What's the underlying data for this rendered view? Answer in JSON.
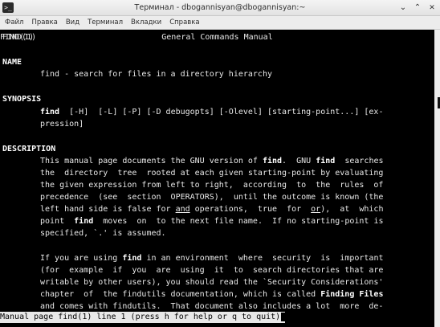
{
  "window": {
    "title": "Терминал - dbogannisyan@dbogannisyan:~",
    "app_icon": "terminal-icon"
  },
  "menu": [
    "Файл",
    "Правка",
    "Вид",
    "Терминал",
    "Вкладки",
    "Справка"
  ],
  "man": {
    "header_left": "FIND(1)",
    "header_center": "General Commands Manual",
    "header_right": "FIND(1)",
    "name_heading": "NAME",
    "name_text": "find - search for files in a directory hierarchy",
    "synopsis_heading": "SYNOPSIS",
    "synopsis_cmd": "find",
    "synopsis_line1": "  [-H]  [-L] [-P] [-D debugopts] [-Olevel] [starting-point...] [ex-",
    "synopsis_line2": "pression]",
    "description_heading": "DESCRIPTION",
    "d1_a": "This manual page documents the GNU version of ",
    "d1_b": "find",
    "d1_c": ".  GNU ",
    "d1_d": "find",
    "d1_e": "  searches",
    "d2": "the  directory  tree  rooted at each given starting-point by evaluating",
    "d3": "the given expression from left to right,  according  to  the  rules  of",
    "d4": "precedence  (see  section  OPERATORS),  until the outcome is known (the",
    "d5_a": "left hand side is false for ",
    "d5_b": "and",
    "d5_c": " operations,  true  for  ",
    "d5_d": "or",
    "d5_e": "),  at  which",
    "d6_a": "point  ",
    "d6_b": "find",
    "d6_c": "  moves  on  to the next file name.  If no starting-point is",
    "d7": "specified, `.' is assumed.",
    "p2_1a": "If you are using ",
    "p2_1b": "find",
    "p2_1c": " in an environment  where  security  is  important",
    "p2_2": "(for  example  if  you  are  using  it  to  search directories that are",
    "p2_3": "writable by other users), you should read the `Security Considerations'",
    "p2_4a": "chapter  of  the findutils documentation, which is called ",
    "p2_4b": "Finding Files",
    "p2_5": "and comes with findutils.  That document also includes a lot  more  de-"
  },
  "status": {
    "text": "Manual page find(1) line 1 (press h for help or q to quit)"
  }
}
